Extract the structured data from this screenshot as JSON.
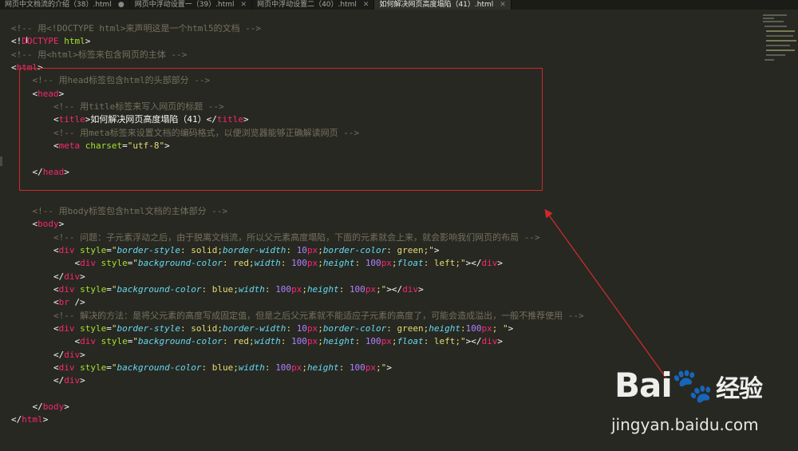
{
  "tabs": [
    {
      "label": "网页中文档流的介绍（38）.html",
      "status": "●"
    },
    {
      "label": "网页中浮动设置一（39）.html",
      "status": "✕"
    },
    {
      "label": "网页中浮动设置二（40）.html",
      "status": "✕"
    },
    {
      "label": "如何解决网页高度塌陷（41）.html",
      "status": "✕"
    }
  ],
  "code": {
    "l1": "<!-- 用<!DOCTYPE html>来声明这是一个html5的文档 -->",
    "l3": "<!-- 用<html>标签来包含网页的主体 -->",
    "l5": "<!-- 用head标签包含html的头部部分 -->",
    "l7": "<!-- 用title标签来写入网页的标题 -->",
    "l8_title": "如何解决网页高度塌陷（41）",
    "l9": "<!-- 用meta标签来设置文档的编码格式，以便浏览器能够正确解读网页 -->",
    "l13": "<!-- 用body标签包含html文档的主体部分 -->",
    "l15": "<!-- 问题：子元素浮动之后，由于脱离文档流，所以父元素高度塌陷，下面的元素就会上来，就会影响我们网页的布局 -->",
    "l21": "<!-- 解决的方法：是将父元素的高度写成固定值，但是之后父元素就不能适应子元素的高度了，可能会造成溢出，一般不推荐使用 -->"
  },
  "watermark": {
    "logo_a": "Bai",
    "logo_paw": "🐾",
    "logo_b": "经验",
    "url": "jingyan.baidu.com"
  },
  "colors": {
    "background": "#272822",
    "comment": "#75715e",
    "tag": "#f92672",
    "attribute": "#a6e22e",
    "string": "#e6db74",
    "css_property": "#66d9ef",
    "number": "#ae81ff",
    "annotation": "#cc2a2a"
  }
}
